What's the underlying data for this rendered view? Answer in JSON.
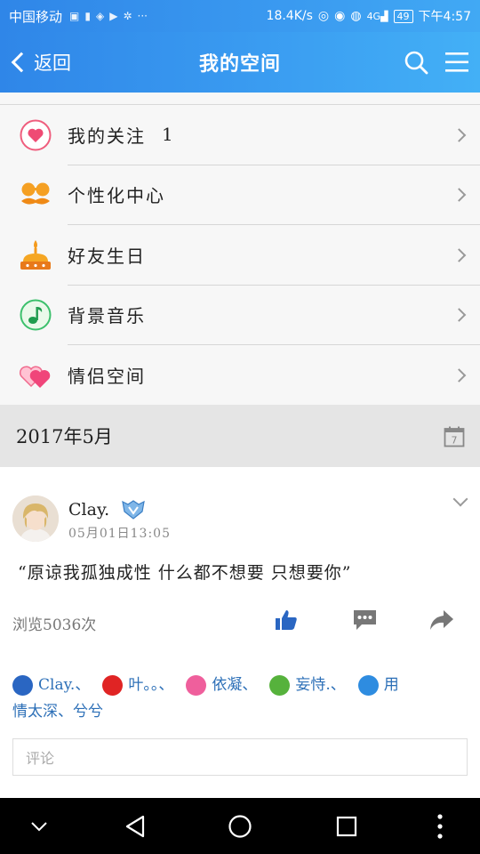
{
  "status_bar": {
    "carrier": "中国移动",
    "speed": "18.4K/s",
    "battery": "49",
    "time": "下午4:57"
  },
  "header": {
    "back_label": "返回",
    "title": "我的空间"
  },
  "menu": {
    "items": [
      {
        "label": "我的关注",
        "count": "1",
        "icon": "heart-icon"
      },
      {
        "label": "个性化中心",
        "icon": "mustache-icon"
      },
      {
        "label": "好友生日",
        "icon": "cake-icon"
      },
      {
        "label": "背景音乐",
        "icon": "music-note-icon"
      },
      {
        "label": "情侣空间",
        "icon": "double-heart-icon"
      }
    ]
  },
  "date_bar": {
    "label": "2017年5月"
  },
  "post": {
    "username": "Clay.",
    "time": "05月01日13:05",
    "text": "“原谅我孤独成性 什么都不想要 只想要你”",
    "views": "浏览5036次",
    "likes_line1": [
      "Clay.、",
      "叶。。、",
      "依凝、",
      "妄恃.、",
      "用"
    ],
    "likes_line2": "情太深、兮兮",
    "comment_placeholder": "评论"
  },
  "colors": {
    "header_start": "#2f86e8",
    "header_end": "#43b0f6",
    "like_name": "#2c6fb7",
    "action_blue": "#2a66c2"
  }
}
